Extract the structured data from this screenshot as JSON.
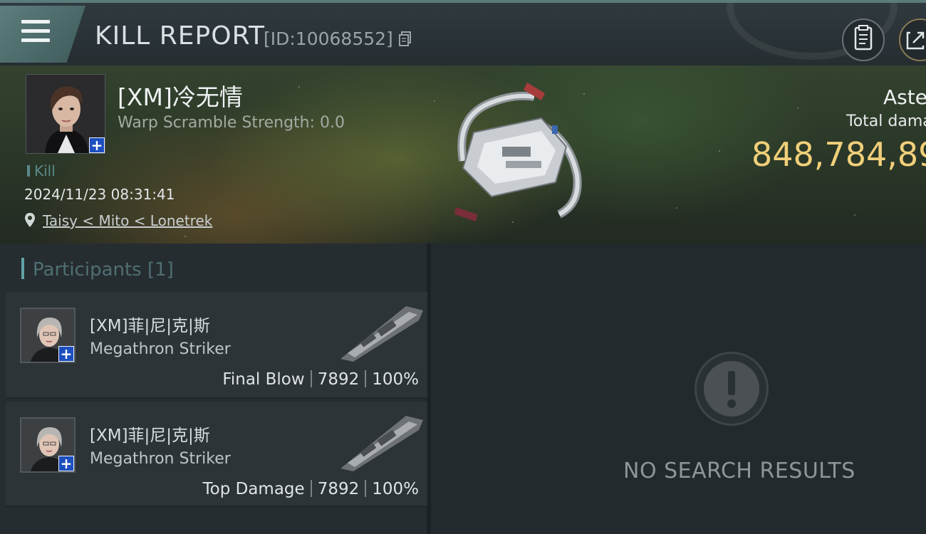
{
  "header": {
    "title": "KILL REPORT",
    "report_id": "[ID:10068552]",
    "icons": [
      "menu-icon",
      "copy-icon",
      "clipboard-icon",
      "share-icon"
    ]
  },
  "victim": {
    "name": "[XM]冷无情",
    "warp_scramble": "Warp Scramble Strength: 0.0",
    "kill_tag": "Kill",
    "timestamp": "2024/11/23 08:31:41",
    "location": "Taisy < Mito < Lonetrek",
    "ship_class": "Aste",
    "damage_label": "Total dama",
    "damage_value": "848,784,89"
  },
  "participants": {
    "header": "Participants [1]",
    "items": [
      {
        "name": "[XM]菲|尼|克|斯",
        "ship": "Megathron Striker",
        "tag": "Final Blow",
        "damage": "7892",
        "percent": "100%"
      },
      {
        "name": "[XM]菲|尼|克|斯",
        "ship": "Megathron Striker",
        "tag": "Top Damage",
        "damage": "7892",
        "percent": "100%"
      }
    ]
  },
  "results": {
    "empty_text": "NO SEARCH RESULTS"
  },
  "colors": {
    "accent": "#5fa4a6",
    "damage_gold": "#f1cf7a",
    "badge_blue": "#1d4fbf"
  }
}
